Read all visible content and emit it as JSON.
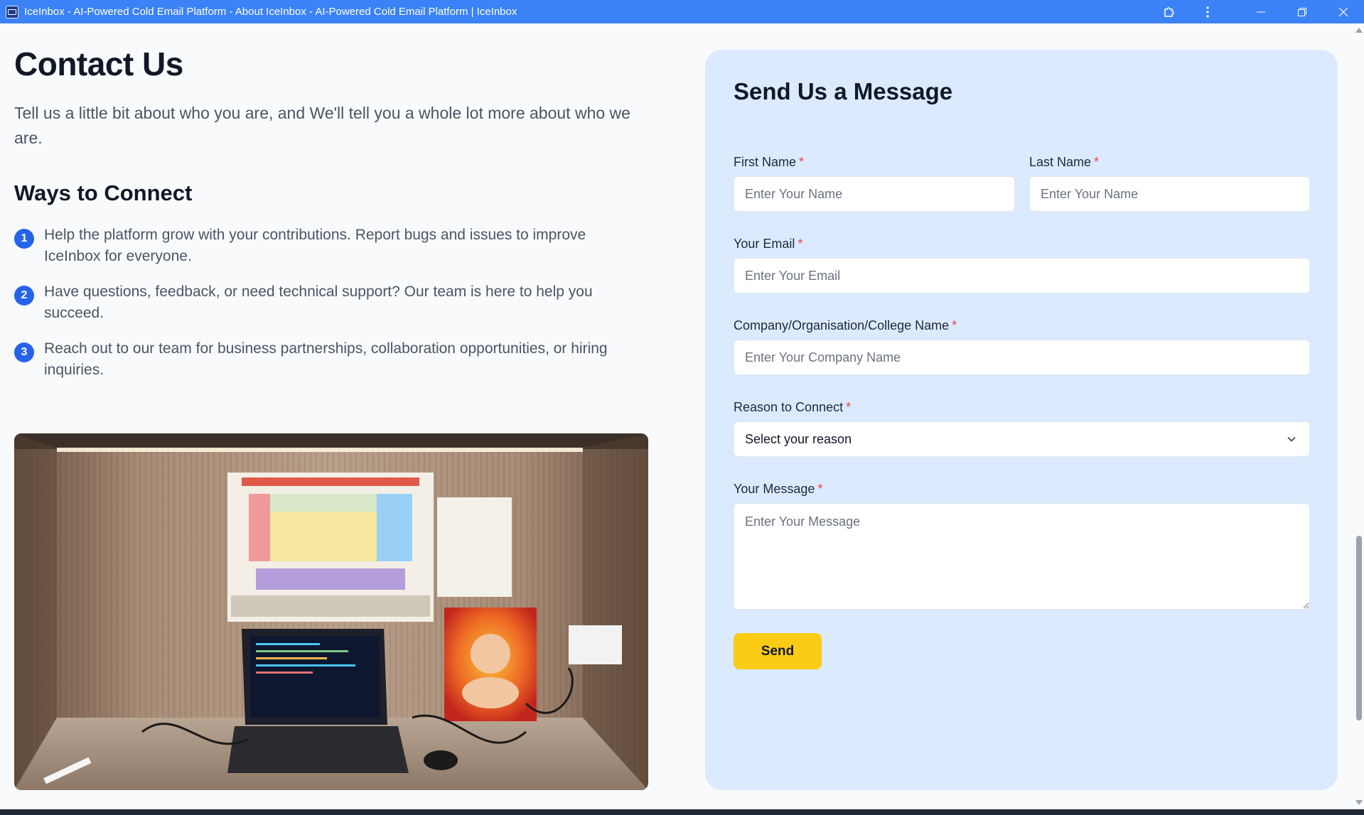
{
  "window": {
    "title": "IceInbox - AI-Powered Cold Email Platform - About IceInbox - AI-Powered Cold Email Platform | IceInbox"
  },
  "left": {
    "title": "Contact Us",
    "intro": "Tell us a little bit about who you are, and We'll tell you a whole lot more about who we are.",
    "ways_title": "Ways to Connect",
    "ways": [
      {
        "num": "1",
        "text": "Help the platform grow with your contributions. Report bugs and issues to improve IceInbox for everyone."
      },
      {
        "num": "2",
        "text": "Have questions, feedback, or need technical support? Our team is here to help you succeed."
      },
      {
        "num": "3",
        "text": "Reach out to our team for business partnerships, collaboration opportunities, or hiring inquiries."
      }
    ]
  },
  "form": {
    "title": "Send Us a Message",
    "first_name": {
      "label": "First Name",
      "placeholder": "Enter Your Name"
    },
    "last_name": {
      "label": "Last Name",
      "placeholder": "Enter Your Name"
    },
    "email": {
      "label": "Your Email",
      "placeholder": "Enter Your Email"
    },
    "company": {
      "label": "Company/Organisation/College Name",
      "placeholder": "Enter Your Company Name"
    },
    "reason": {
      "label": "Reason to Connect",
      "value": "Select your reason"
    },
    "message": {
      "label": "Your Message",
      "placeholder": "Enter Your Message"
    },
    "required_mark": "*",
    "send_label": "Send"
  },
  "colors": {
    "titlebar": "#3b82f6",
    "panel_bg": "#dbeafe",
    "accent_blue": "#2563eb",
    "send_button": "#facc15",
    "required": "#ef4444"
  },
  "icons": {
    "titlebar": [
      "app-icon",
      "extensions-icon",
      "more-vert-icon",
      "minimize-icon",
      "restore-icon",
      "close-icon"
    ],
    "select": "chevron-down-icon"
  }
}
